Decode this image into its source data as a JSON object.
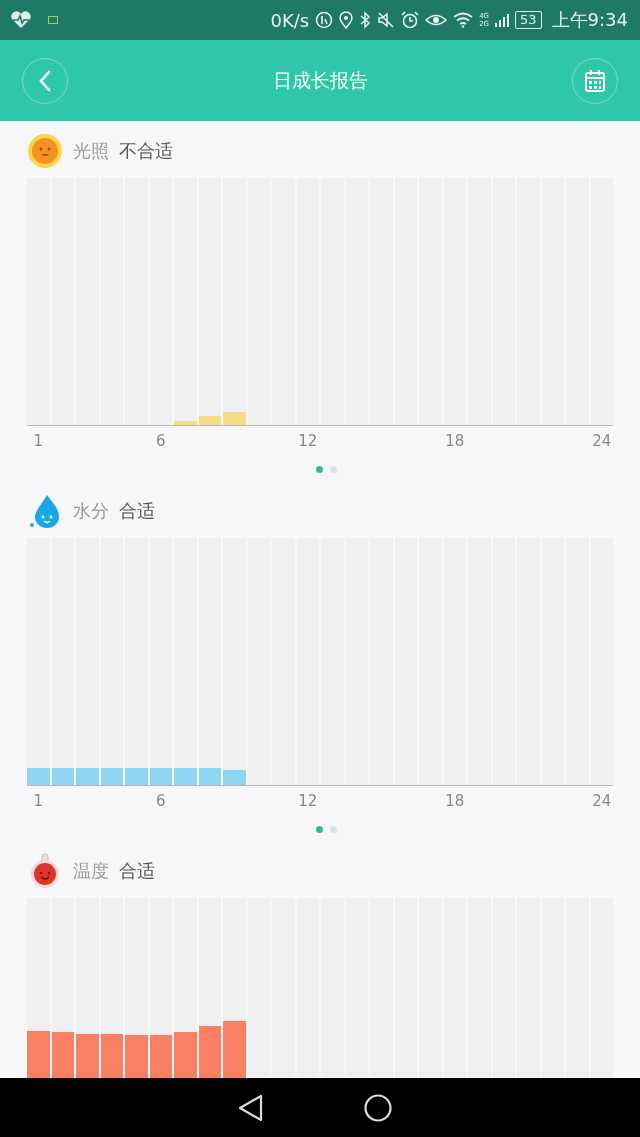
{
  "status_bar": {
    "speed": "0K/s",
    "network_labels": [
      "4G",
      "2G"
    ],
    "battery": "53",
    "time": "上午9:34"
  },
  "header": {
    "title": "日成长报告"
  },
  "sections": [
    {
      "kind": "light",
      "label": "光照",
      "status": "不合适",
      "axis_labels": [
        "1",
        "6",
        "12",
        "18",
        "24"
      ],
      "pages": [
        {
          "selected": true
        },
        {
          "selected": false
        }
      ]
    },
    {
      "kind": "water",
      "label": "水分",
      "status": "合适",
      "axis_labels": [
        "1",
        "6",
        "12",
        "18",
        "24"
      ],
      "pages": [
        {
          "selected": true
        },
        {
          "selected": false
        }
      ]
    },
    {
      "kind": "temperature",
      "label": "温度",
      "status": "合适"
    }
  ]
}
